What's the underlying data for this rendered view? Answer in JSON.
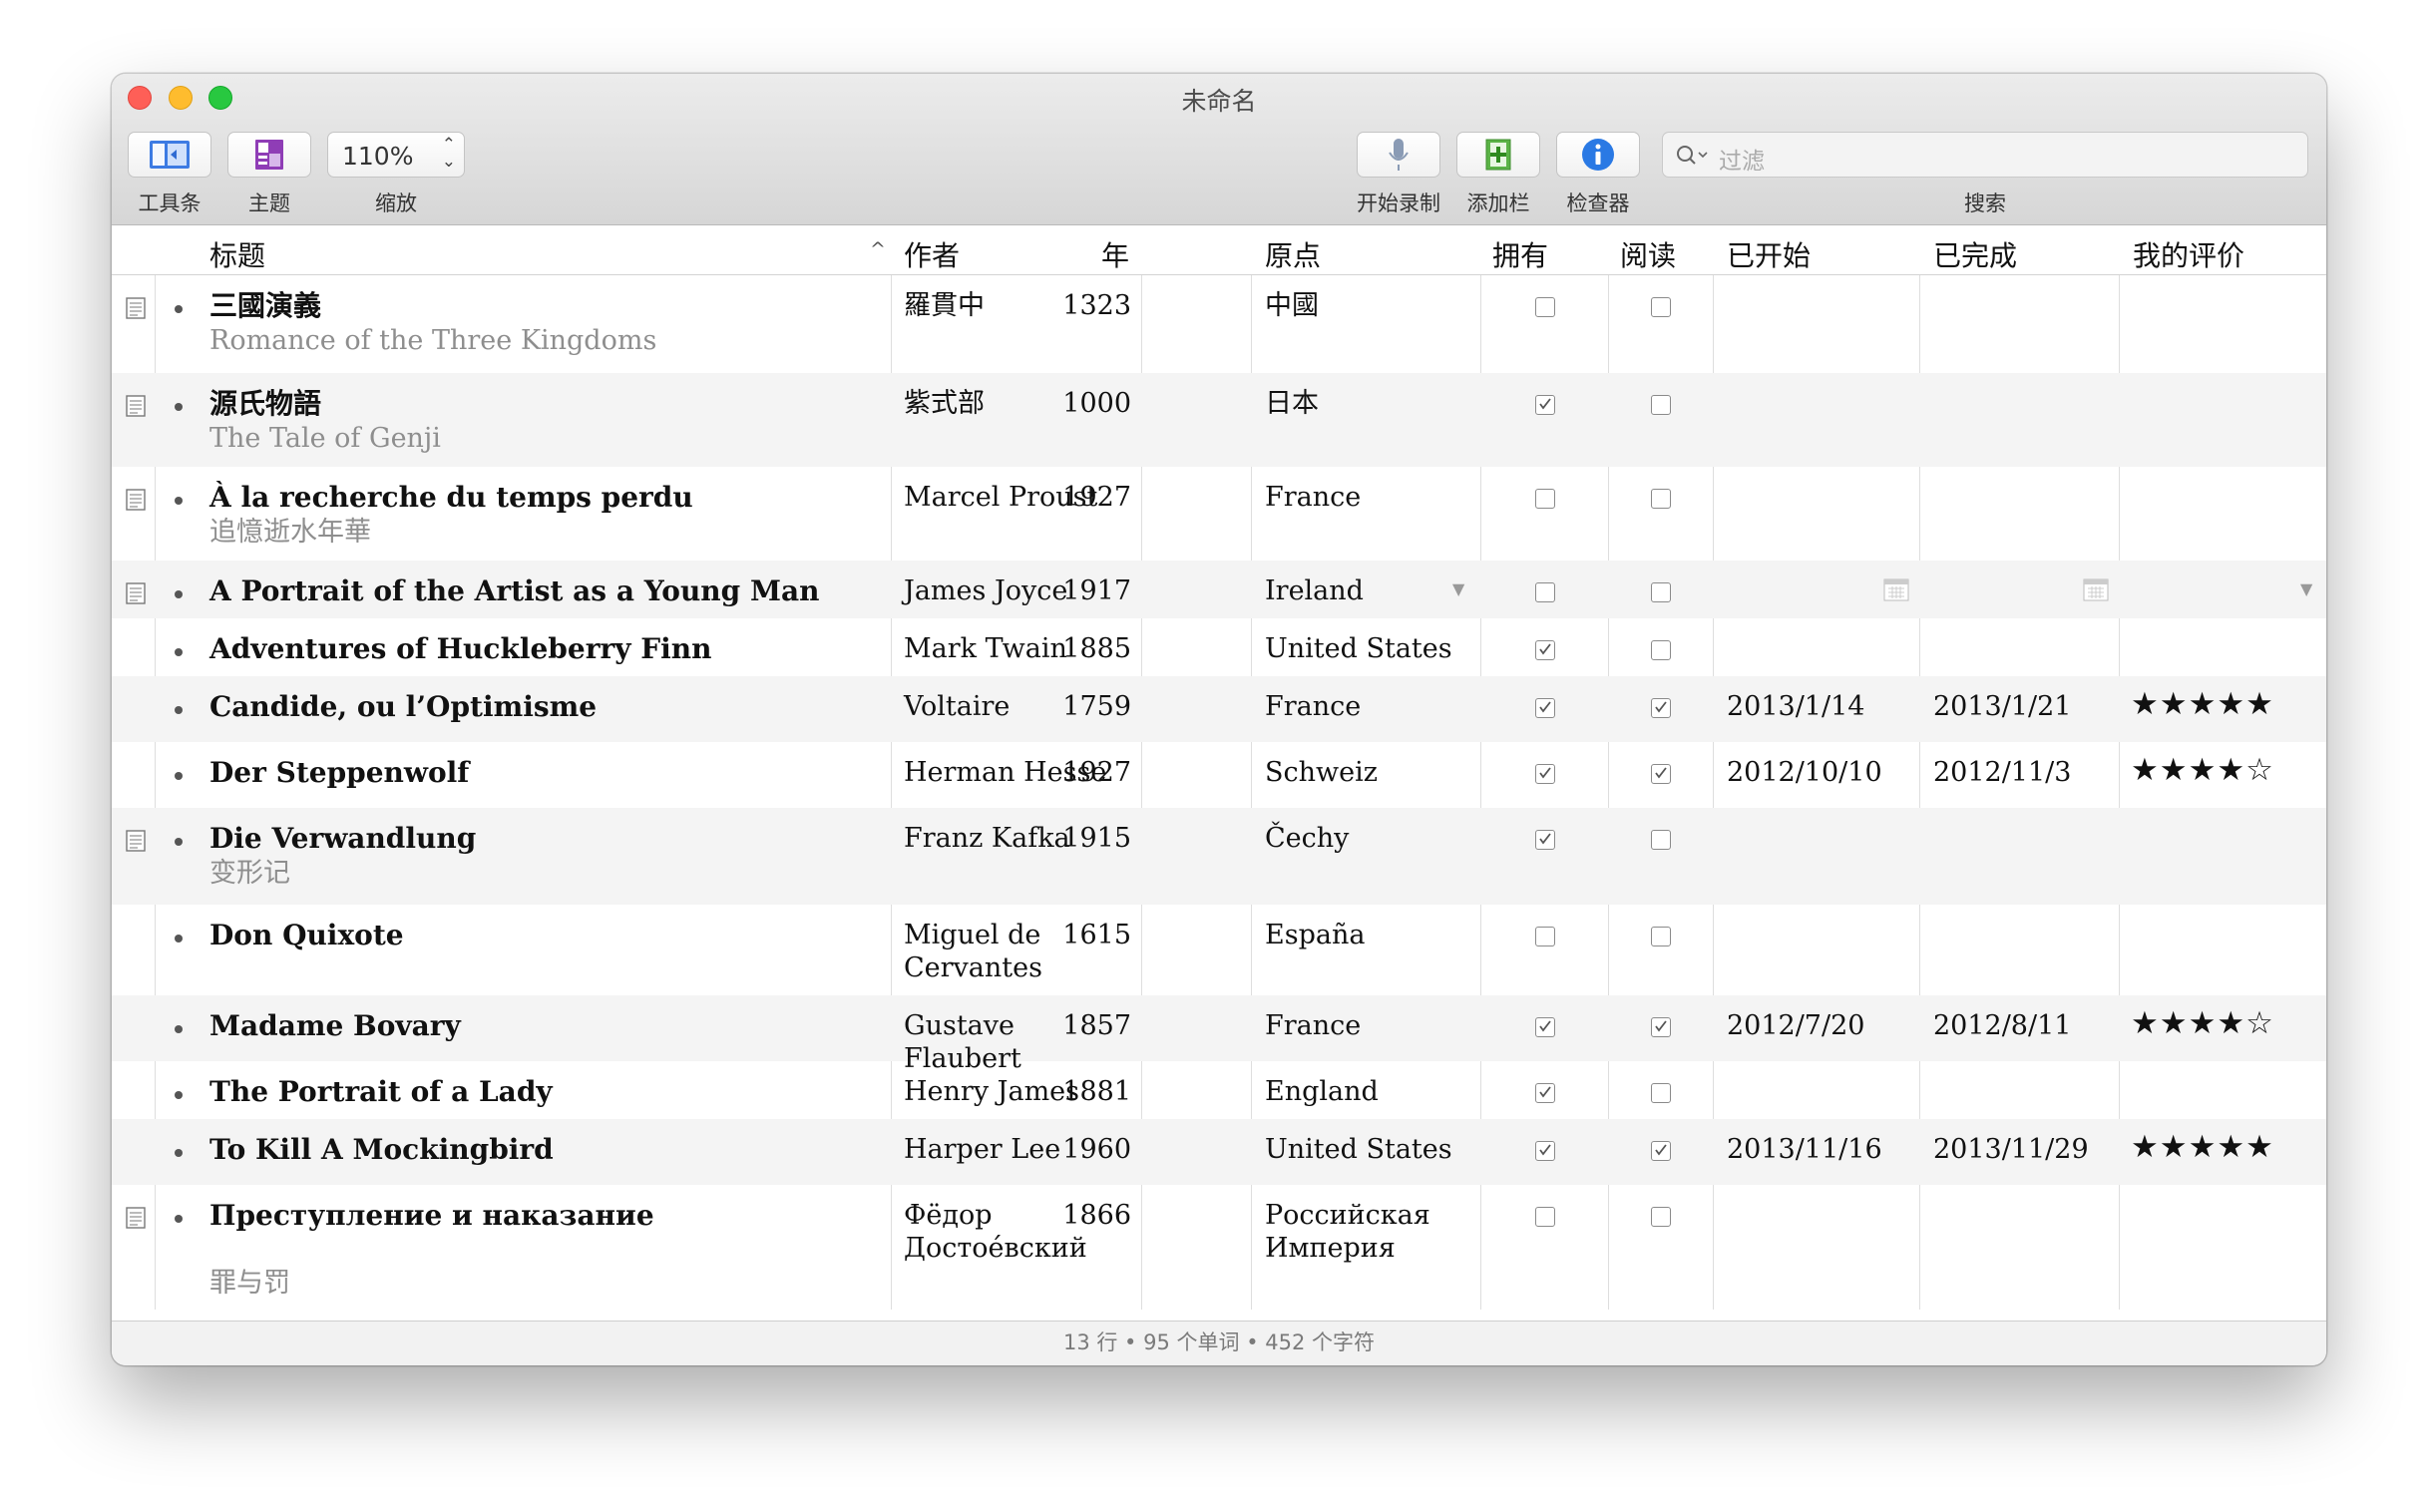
{
  "window": {
    "title": "未命名"
  },
  "toolbar": {
    "toolbar_label": "工具条",
    "theme_label": "主题",
    "zoom_label": "缩放",
    "zoom_value": "110%",
    "record_label": "开始录制",
    "add_column_label": "添加栏",
    "inspector_label": "检查器",
    "search_label": "搜索",
    "search_placeholder": "过滤"
  },
  "columns": [
    "标题",
    "作者",
    "年",
    "原点",
    "拥有",
    "阅读",
    "已开始",
    "已完成",
    "我的评价"
  ],
  "rows": [
    {
      "title": "三國演義",
      "subtitle": "Romance of the Three Kingdoms",
      "author": "羅貫中",
      "year": "1323",
      "origin": "中國",
      "own": false,
      "read": false,
      "started": "",
      "finished": "",
      "rating": "",
      "note": true
    },
    {
      "title": "源氏物語",
      "subtitle": "The Tale of Genji",
      "author": "紫式部",
      "year": "1000",
      "origin": "日本",
      "own": true,
      "read": false,
      "started": "",
      "finished": "",
      "rating": "",
      "note": true
    },
    {
      "title": "À la recherche du temps perdu",
      "subtitle": "追憶逝水年華",
      "author": "Marcel Proust",
      "year": "1927",
      "origin": "France",
      "own": false,
      "read": false,
      "started": "",
      "finished": "",
      "rating": "",
      "note": true
    },
    {
      "title": "A Portrait of the Artist as a Young Man",
      "subtitle": "",
      "author": "James Joyce",
      "year": "1917",
      "origin": "Ireland",
      "own": false,
      "read": false,
      "started": "",
      "finished": "",
      "rating": "",
      "note": true
    },
    {
      "title": "Adventures of Huckleberry Finn",
      "subtitle": "",
      "author": "Mark Twain",
      "year": "1885",
      "origin": "United States",
      "own": true,
      "read": false,
      "started": "",
      "finished": "",
      "rating": "",
      "note": false
    },
    {
      "title": "Candide, ou l’Optimisme",
      "subtitle": "",
      "author": "Voltaire",
      "year": "1759",
      "origin": "France",
      "own": true,
      "read": true,
      "started": "2013/1/14",
      "finished": "2013/1/21",
      "rating": "★★★★★",
      "note": false
    },
    {
      "title": "Der Steppenwolf",
      "subtitle": "",
      "author": "Herman Hesse",
      "year": "1927",
      "origin": "Schweiz",
      "own": true,
      "read": true,
      "started": "2012/10/10",
      "finished": "2012/11/3",
      "rating": "★★★★☆",
      "note": false
    },
    {
      "title": "Die Verwandlung",
      "subtitle": "变形记",
      "author": "Franz Kafka",
      "year": "1915",
      "origin": "Čechy",
      "own": true,
      "read": false,
      "started": "",
      "finished": "",
      "rating": "",
      "note": true
    },
    {
      "title": "Don Quixote",
      "subtitle": "",
      "author": "Miguel de Cervantes",
      "year": "1615",
      "origin": "España",
      "own": false,
      "read": false,
      "started": "",
      "finished": "",
      "rating": "",
      "note": false
    },
    {
      "title": "Madame Bovary",
      "subtitle": "",
      "author": "Gustave Flaubert",
      "year": "1857",
      "origin": "France",
      "own": true,
      "read": true,
      "started": "2012/7/20",
      "finished": "2012/8/11",
      "rating": "★★★★☆",
      "note": false
    },
    {
      "title": "The Portrait of a Lady",
      "subtitle": "",
      "author": "Henry James",
      "year": "1881",
      "origin": "England",
      "own": true,
      "read": false,
      "started": "",
      "finished": "",
      "rating": "",
      "note": false
    },
    {
      "title": "To Kill A Mockingbird",
      "subtitle": "",
      "author": "Harper Lee",
      "year": "1960",
      "origin": "United States",
      "own": true,
      "read": true,
      "started": "2013/11/16",
      "finished": "2013/11/29",
      "rating": "★★★★★",
      "note": false
    },
    {
      "title": "Преступление и наказание",
      "subtitle": "罪与罚",
      "author": "Фёдор Достое́вский",
      "year": "1866",
      "origin": "Российская Империя",
      "own": false,
      "read": false,
      "started": "",
      "finished": "",
      "rating": "",
      "note": true
    }
  ],
  "status": "13 行 • 95 个单词 • 452 个字符"
}
